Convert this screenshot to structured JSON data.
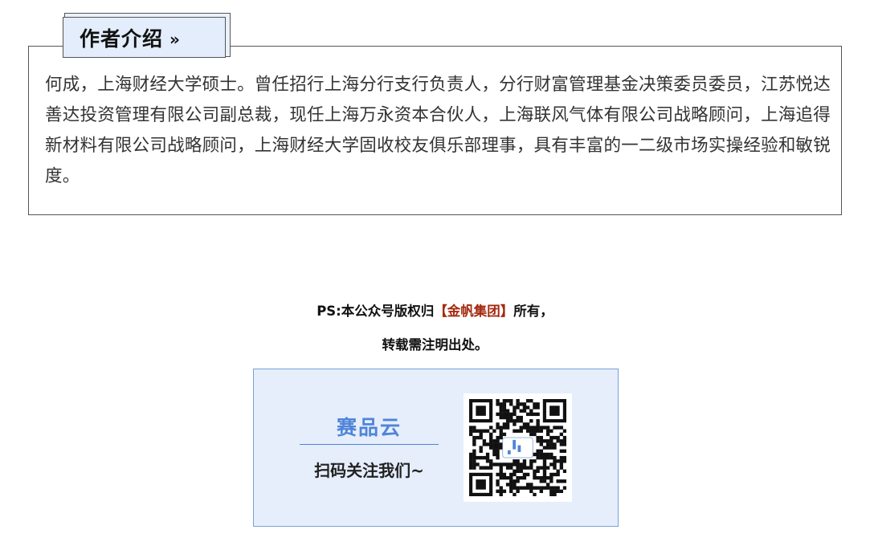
{
  "author_intro": {
    "tab_title": "作者介绍",
    "tab_arrows": "»",
    "bio": "何成，上海财经大学硕士。曾任招行上海分行支行负责人，分行财富管理基金决策委员委员，江苏悦达善达投资管理有限公司副总裁，现任上海万永资本合伙人，上海联风气体有限公司战略顾问，上海追得新材料有限公司战略顾问，上海财经大学固收校友俱乐部理事，具有丰富的一二级市场实操经验和敏锐度。"
  },
  "copyright": {
    "prefix": "PS:本公众号版权归",
    "brand": "【金帆集团】",
    "suffix": "所有，",
    "line2": "转载需注明出处。"
  },
  "qr_card": {
    "brand_name": "赛品云",
    "call_to_action": "扫码关注我们~",
    "qr_icon": "qr-code-icon"
  },
  "colors": {
    "card_bg": "#e6eefc",
    "brand_blue": "#4f85d7",
    "brand_red": "#a52a10"
  }
}
